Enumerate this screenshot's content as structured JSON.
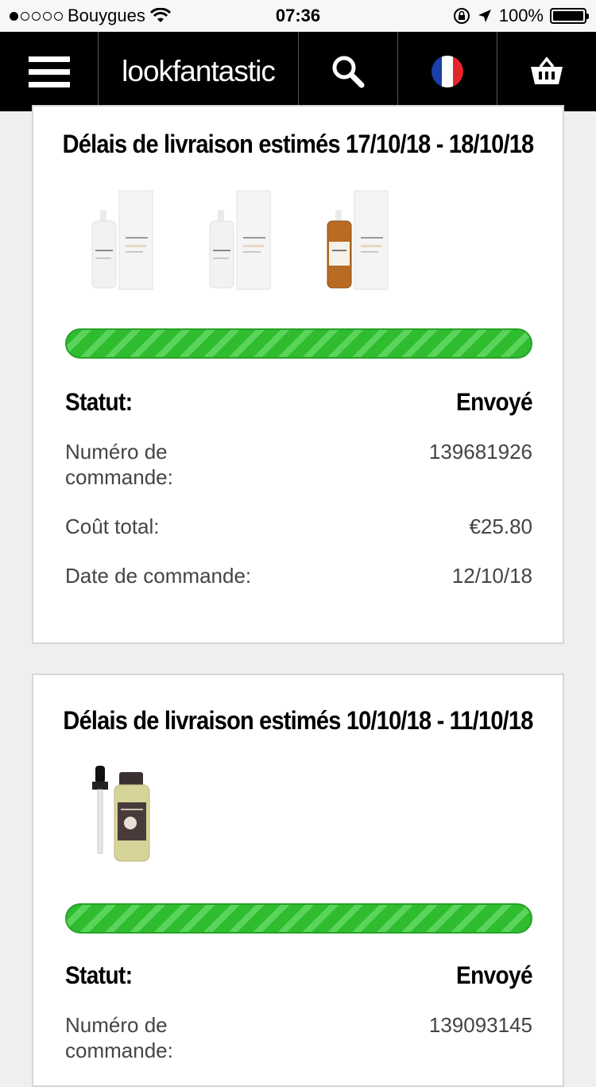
{
  "status_bar": {
    "carrier": "Bouygues",
    "time": "07:36",
    "battery": "100%"
  },
  "nav": {
    "logo": "lookfantastic"
  },
  "orders": [
    {
      "title": "Délais de livraison estimés 17/10/18 - 18/10/18",
      "progress": 1.0,
      "status_label": "Statut:",
      "status_value": "Envoyé",
      "order_label": "Numéro de commande:",
      "order_value": "139681926",
      "total_label": "Coût total:",
      "total_value": "€25.80",
      "date_label": "Date de commande:",
      "date_value": "12/10/18"
    },
    {
      "title": "Délais de livraison estimés 10/10/18 - 11/10/18",
      "progress": 1.0,
      "status_label": "Statut:",
      "status_value": "Envoyé",
      "order_label": "Numéro de commande:",
      "order_value": "139093145"
    }
  ],
  "colors": {
    "progress_green": "#2fbc2f",
    "nav_black": "#000000"
  }
}
